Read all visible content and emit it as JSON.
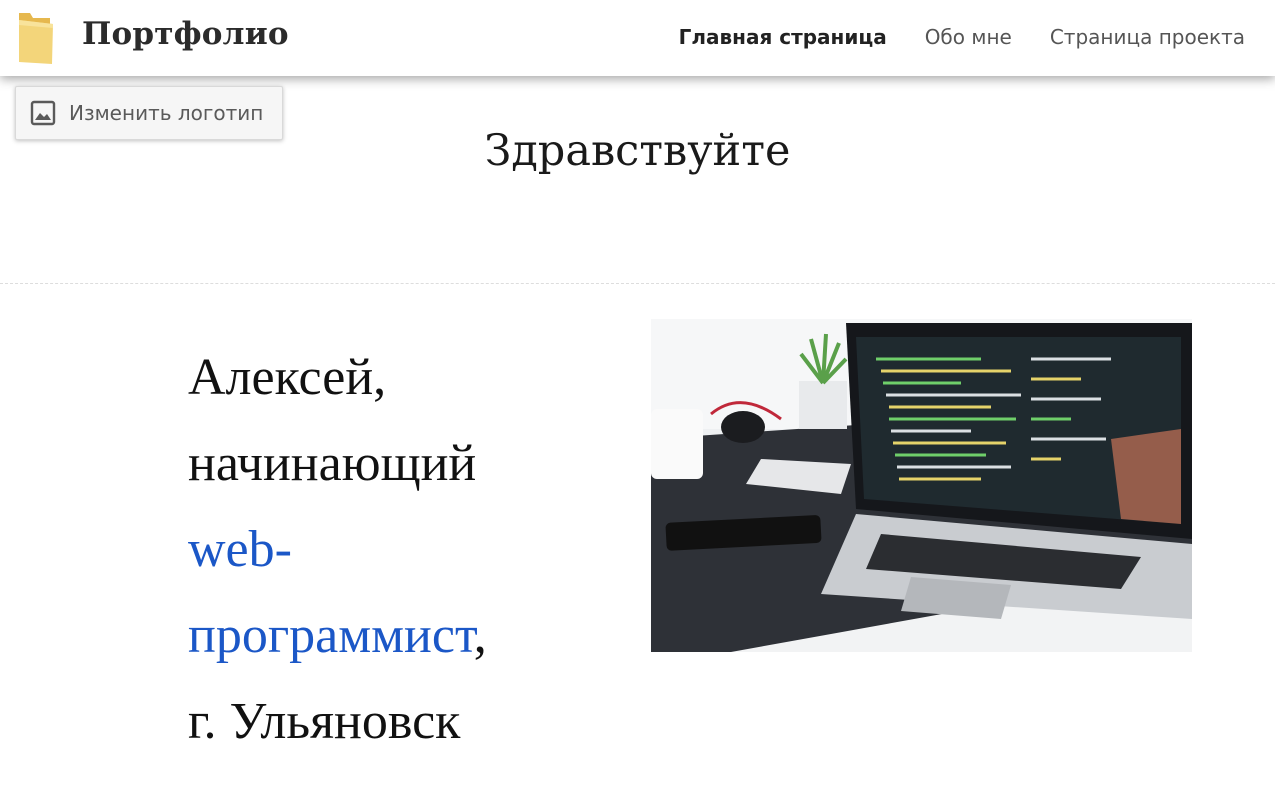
{
  "header": {
    "logo_icon": "folder-icon",
    "title": "Портфолио",
    "nav": [
      {
        "label": "Главная страница",
        "active": true
      },
      {
        "label": "Обо мне",
        "active": false
      },
      {
        "label": "Страница проекта",
        "active": false
      }
    ]
  },
  "logo_editor": {
    "button_label": "Изменить логотип",
    "icon": "image-icon"
  },
  "main": {
    "greeting": "Здравствуйте",
    "intro": {
      "line1": "Алексей,",
      "line2": "начинающий",
      "line3": "web-",
      "line4_accent": "программист",
      "line4_rest": ",",
      "line5": "г. Ульяновск"
    },
    "hero_image": "laptop-with-code-photo"
  },
  "colors": {
    "accent": "#1b57c7",
    "folder": "#f3d57a"
  }
}
